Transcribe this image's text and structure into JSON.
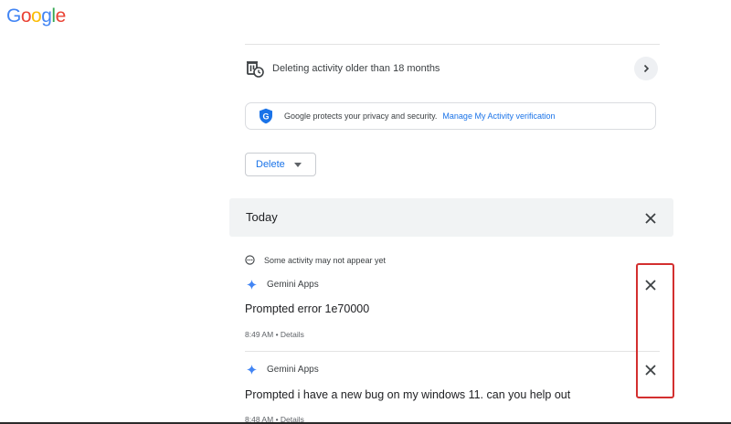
{
  "logo": {
    "letters": [
      "G",
      "o",
      "o",
      "g",
      "l",
      "e"
    ],
    "colors": [
      "#4285F4",
      "#EA4335",
      "#FBBC05",
      "#4285F4",
      "#34A853",
      "#EA4335"
    ]
  },
  "auto_delete": {
    "label": "Deleting activity older than 18 months",
    "icon": "auto-delete-icon",
    "action_icon": "chevron-right-icon"
  },
  "privacy": {
    "text": "Google protects your privacy and security.",
    "link": "Manage My Activity verification",
    "icon": "google-shield-icon"
  },
  "delete_menu": {
    "label": "Delete",
    "icon": "dropdown-caret-icon"
  },
  "day_group": {
    "title": "Today",
    "action_icon": "close-icon"
  },
  "notice": {
    "text": "Some activity may not appear yet",
    "icon": "pending-icon"
  },
  "items": [
    {
      "app": "Gemini Apps",
      "title": "Prompted error 1e70000",
      "time": "8:49 AM",
      "details": "Details",
      "separator": "•"
    },
    {
      "app": "Gemini Apps",
      "title": "Prompted i have a new bug on my windows 11. can you help out",
      "time": "8:48 AM",
      "details": "Details",
      "separator": "•"
    }
  ],
  "colors": {
    "link_blue": "#1a73e8",
    "highlight_red": "#d32f2f",
    "gemini_blue": "#4285F4"
  }
}
